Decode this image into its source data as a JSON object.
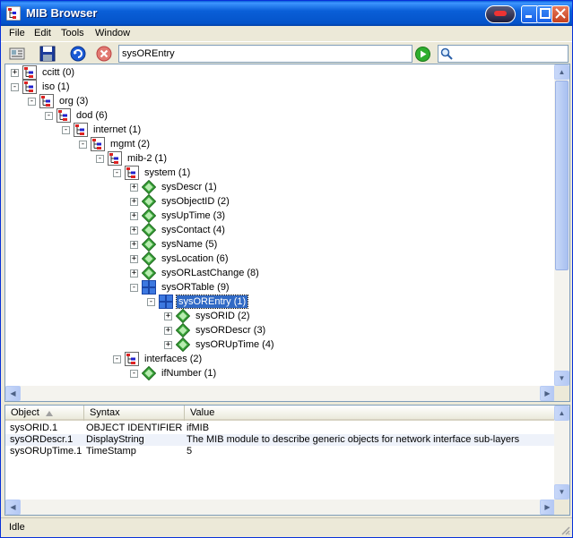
{
  "window": {
    "title": "MIB Browser"
  },
  "menu": [
    "File",
    "Edit",
    "Tools",
    "Window"
  ],
  "toolbar": {
    "address_value": "sysOREntry",
    "search_value": ""
  },
  "tree": [
    {
      "label": "ccitt (0)",
      "level": 0,
      "exp": "+",
      "icon": "folder-tree-icon"
    },
    {
      "label": "iso (1)",
      "level": 0,
      "exp": "-",
      "icon": "folder-tree-icon"
    },
    {
      "label": "org (3)",
      "level": 1,
      "exp": "-",
      "icon": "folder-tree-icon"
    },
    {
      "label": "dod (6)",
      "level": 2,
      "exp": "-",
      "icon": "folder-tree-icon"
    },
    {
      "label": "internet (1)",
      "level": 3,
      "exp": "-",
      "icon": "folder-tree-icon"
    },
    {
      "label": "mgmt (2)",
      "level": 4,
      "exp": "-",
      "icon": "folder-tree-icon"
    },
    {
      "label": "mib-2 (1)",
      "level": 5,
      "exp": "-",
      "icon": "folder-tree-icon"
    },
    {
      "label": "system (1)",
      "level": 6,
      "exp": "-",
      "icon": "folder-tree-icon"
    },
    {
      "label": "sysDescr (1)",
      "level": 7,
      "exp": "+",
      "icon": "leaf-object-icon"
    },
    {
      "label": "sysObjectID (2)",
      "level": 7,
      "exp": "+",
      "icon": "leaf-object-icon"
    },
    {
      "label": "sysUpTime (3)",
      "level": 7,
      "exp": "+",
      "icon": "leaf-object-icon"
    },
    {
      "label": "sysContact (4)",
      "level": 7,
      "exp": "+",
      "icon": "leaf-object-icon"
    },
    {
      "label": "sysName (5)",
      "level": 7,
      "exp": "+",
      "icon": "leaf-object-icon"
    },
    {
      "label": "sysLocation (6)",
      "level": 7,
      "exp": "+",
      "icon": "leaf-object-icon"
    },
    {
      "label": "sysORLastChange (8)",
      "level": 7,
      "exp": "+",
      "icon": "leaf-object-icon"
    },
    {
      "label": "sysORTable (9)",
      "level": 7,
      "exp": "-",
      "icon": "table-grid-icon"
    },
    {
      "label": "sysOREntry (1)",
      "level": 8,
      "exp": "-",
      "icon": "table-grid-icon",
      "selected": true
    },
    {
      "label": "sysORID (2)",
      "level": 9,
      "exp": "+",
      "icon": "leaf-object-icon"
    },
    {
      "label": "sysORDescr (3)",
      "level": 9,
      "exp": "+",
      "icon": "leaf-object-icon"
    },
    {
      "label": "sysORUpTime (4)",
      "level": 9,
      "exp": "+",
      "icon": "leaf-object-icon"
    },
    {
      "label": "interfaces (2)",
      "level": 6,
      "exp": "-",
      "icon": "folder-tree-icon"
    },
    {
      "label": "ifNumber (1)",
      "level": 7,
      "exp": "-",
      "icon": "leaf-object-icon"
    }
  ],
  "list": {
    "columns": [
      "Object",
      "Syntax",
      "Value"
    ],
    "rows": [
      {
        "object": "sysORID.1",
        "syntax": "OBJECT IDENTIFIER",
        "value": "ifMIB"
      },
      {
        "object": "sysORDescr.1",
        "syntax": "DisplayString",
        "value": "The MIB module to describe generic objects for network interface sub-layers"
      },
      {
        "object": "sysORUpTime.1",
        "syntax": "TimeStamp",
        "value": "5"
      }
    ]
  },
  "status": {
    "text": "Idle"
  },
  "colors": {
    "selection": "#316ac5",
    "titlebar": "#0a5fd8",
    "leaf_icon": "#3aa33a"
  }
}
